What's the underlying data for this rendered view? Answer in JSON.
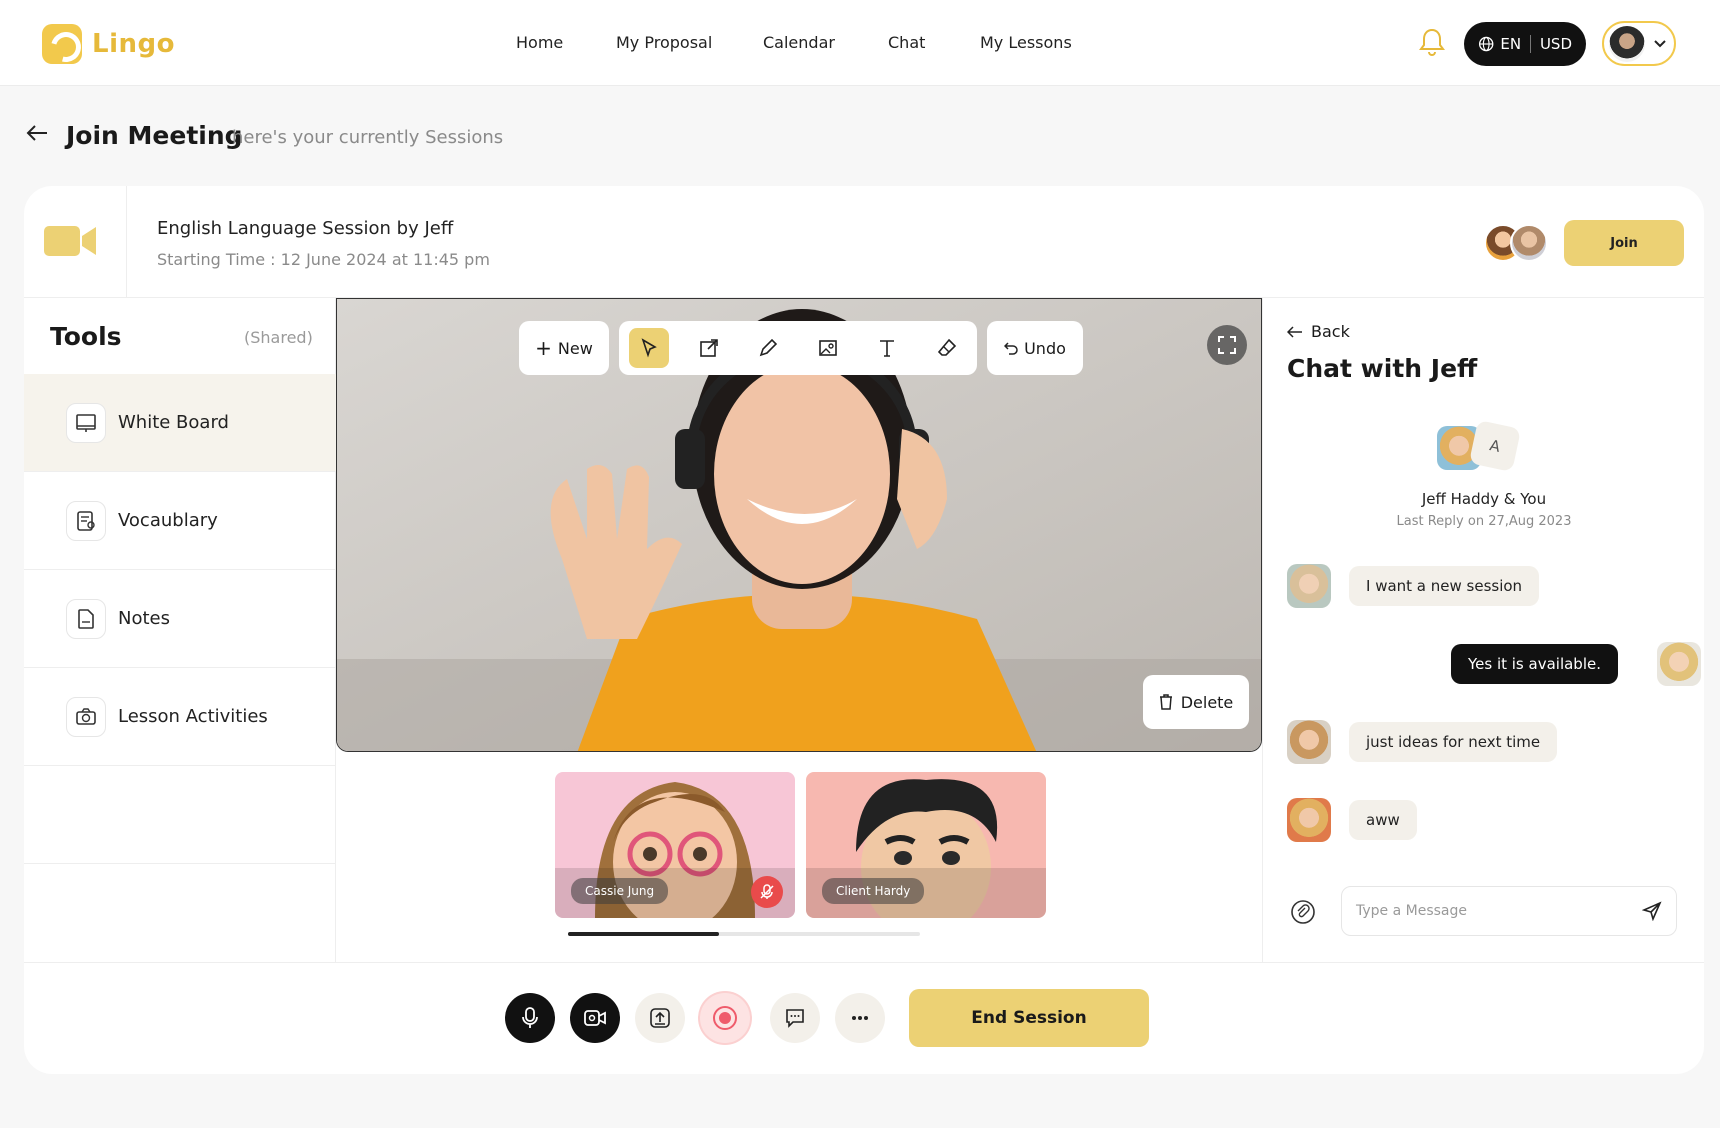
{
  "brand": {
    "name": "Lingo",
    "accent": "#ecd174"
  },
  "nav": {
    "links": [
      "Home",
      "My Proposal",
      "Calendar",
      "Chat",
      "My Lessons"
    ],
    "lang": "EN",
    "currency": "USD"
  },
  "page": {
    "title": "Join Meeting",
    "subtitle": "here's your currently Sessions"
  },
  "session": {
    "title": "English Language Session by Jeff",
    "time": "Starting Time : 12 June 2024 at 11:45 pm",
    "join_label": "Join"
  },
  "tools": {
    "title": "Tools",
    "shared": "(Shared)",
    "items": [
      {
        "label": "White Board",
        "icon": "whiteboard-icon"
      },
      {
        "label": "Vocaublary",
        "icon": "vocabulary-icon"
      },
      {
        "label": "Notes",
        "icon": "notes-icon"
      },
      {
        "label": "Lesson Activities",
        "icon": "lesson-activities-icon"
      }
    ]
  },
  "whiteboard": {
    "new_label": "New",
    "undo_label": "Undo",
    "delete_label": "Delete",
    "tools": [
      "pointer-icon",
      "resize-icon",
      "pencil-icon",
      "image-icon",
      "text-icon",
      "eraser-icon"
    ]
  },
  "participants": [
    {
      "name": "Cassie Jung",
      "muted": true
    },
    {
      "name": "Client Hardy",
      "muted": false
    }
  ],
  "participants_scroll": 0.43,
  "chat": {
    "back_label": "Back",
    "title": "Chat with Jeff",
    "avatar_letter": "A",
    "names": "Jeff Haddy & You",
    "last_reply": "Last Reply on 27,Aug 2023",
    "messages": [
      {
        "text": "I want a new session",
        "from": "them"
      },
      {
        "text": "Yes it is available.",
        "from": "me"
      },
      {
        "text": "just ideas for next time",
        "from": "them"
      },
      {
        "text": "aww",
        "from": "them"
      }
    ],
    "input_placeholder": "Type a Message"
  },
  "controls": {
    "buttons": [
      "mic-icon",
      "camera-icon",
      "share-screen-icon",
      "record-icon",
      "chat-bubble-icon",
      "more-icon"
    ],
    "end_label": "End Session"
  }
}
